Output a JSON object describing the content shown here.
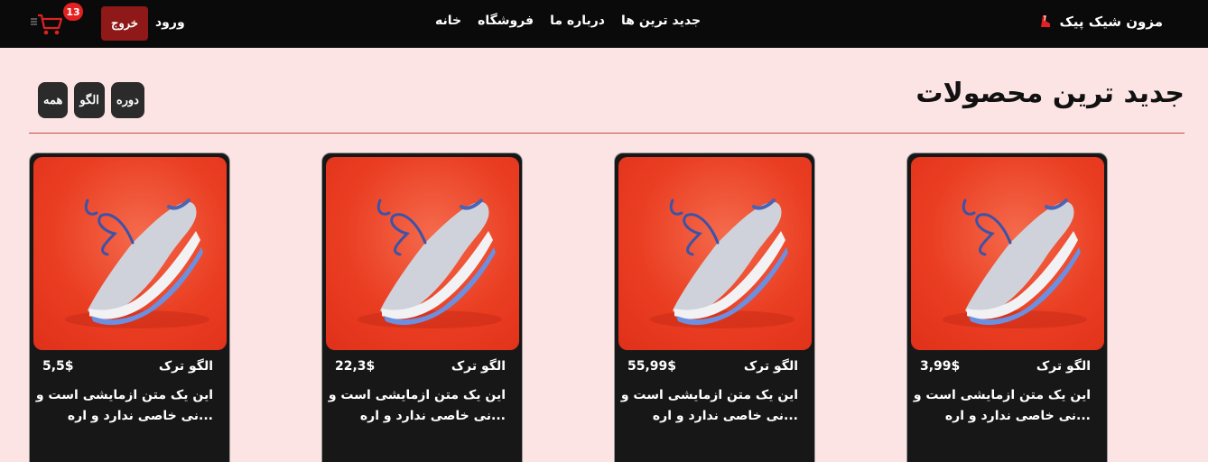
{
  "nav": {
    "brand": "مزون شیک پیک",
    "links": [
      "خانه",
      "فروشگاه",
      "درباره ما",
      "جدید ترین ها"
    ],
    "logout": "خروج",
    "login": "ورود",
    "cart_count": "13"
  },
  "section": {
    "title": "جدید ترین محصولات",
    "filters": [
      "همه",
      "الگو",
      "دوره"
    ]
  },
  "products": [
    {
      "name": "الگو ترک",
      "price": "3,99$",
      "desc": "این یک متن ازمایشی است و\n...نی خاصی ندارد و اره"
    },
    {
      "name": "الگو ترک",
      "price": "55,99$",
      "desc": "این یک متن ازمایشی است و\n...نی خاصی ندارد و اره"
    },
    {
      "name": "الگو ترک",
      "price": "22,3$",
      "desc": "این یک متن ازمایشی است و\n...نی خاصی ندارد و اره"
    },
    {
      "name": "الگو ترک",
      "price": "5,5$",
      "desc": "این یک متن ازمایشی است و\n...نی خاصی ندارد و اره"
    }
  ],
  "colors": {
    "navbar": "#0a0a0a",
    "page_bg": "#fde4e4",
    "logout_bg": "#8f1818",
    "badge": "#e52020",
    "card_bg": "#171717",
    "filter_bg": "#2b2b2b"
  },
  "icons": [
    "brand-logo-icon",
    "cart-icon",
    "sneaker-image"
  ]
}
